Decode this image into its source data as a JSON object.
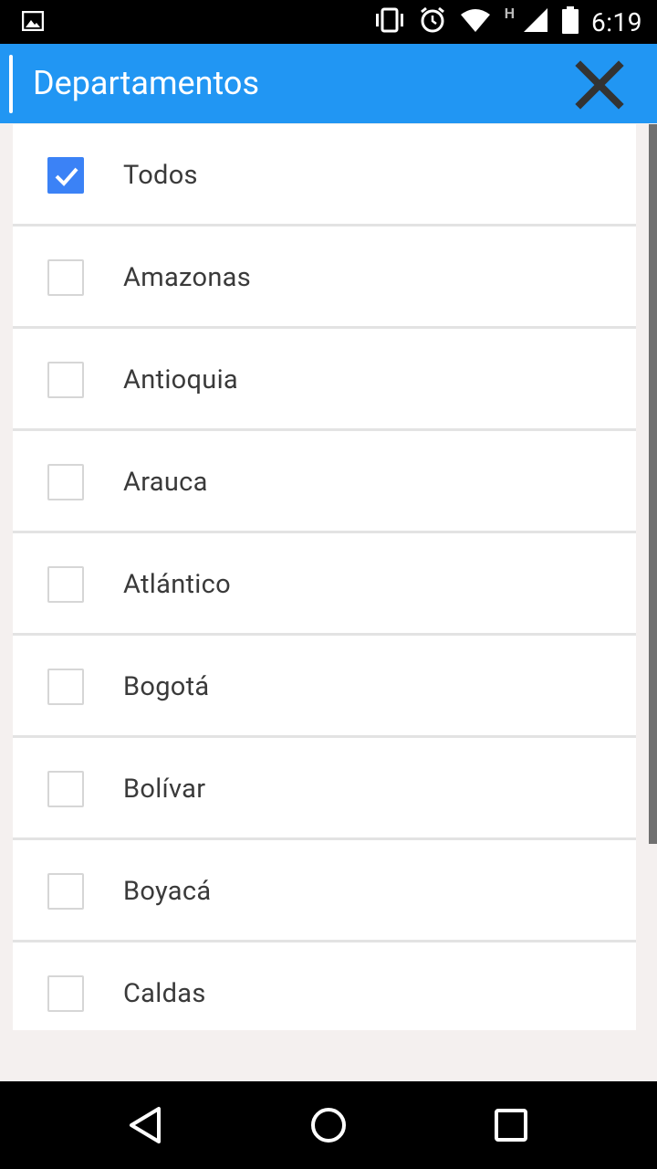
{
  "status_bar": {
    "time": "6:19",
    "network_label": "H",
    "icons": [
      "image-notification-icon",
      "vibrate-icon",
      "alarm-icon",
      "wifi-icon",
      "signal-icon",
      "battery-icon"
    ]
  },
  "app_bar": {
    "title": "Departamentos",
    "background_color": "#2196f3",
    "close_icon": "close-icon"
  },
  "list": {
    "items": [
      {
        "label": "Todos",
        "checked": true
      },
      {
        "label": "Amazonas",
        "checked": false
      },
      {
        "label": "Antioquia",
        "checked": false
      },
      {
        "label": "Arauca",
        "checked": false
      },
      {
        "label": "Atlántico",
        "checked": false
      },
      {
        "label": "Bogotá",
        "checked": false
      },
      {
        "label": "Bolívar",
        "checked": false
      },
      {
        "label": "Boyacá",
        "checked": false
      },
      {
        "label": "Caldas",
        "checked": false
      }
    ],
    "checkbox_checked_color": "#3b82f6"
  },
  "nav_bar": {
    "buttons": [
      "back-icon",
      "home-icon",
      "recents-icon"
    ]
  }
}
